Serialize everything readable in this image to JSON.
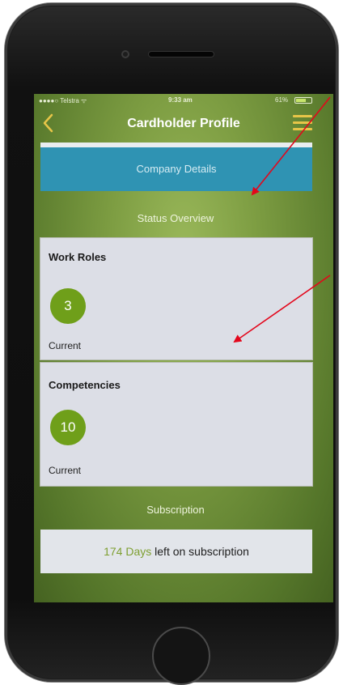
{
  "status_bar": {
    "carrier": "●●●●○ Telstra ᯤ",
    "time": "9:33 am",
    "battery": "61%"
  },
  "nav": {
    "title": "Cardholder Profile",
    "back_icon": "chevron-left-icon",
    "menu_icon": "hamburger-menu-icon",
    "menu_color": "#e7c548"
  },
  "company_details": {
    "label": "Company Details"
  },
  "status_overview": {
    "heading": "Status Overview",
    "work_roles": {
      "title": "Work Roles",
      "count": "3",
      "label": "Current"
    },
    "competencies": {
      "title": "Competencies",
      "count": "10",
      "label": "Current"
    }
  },
  "subscription": {
    "heading": "Subscription",
    "days": "174 Days",
    "suffix": " left on subscription"
  },
  "colors": {
    "accent": "#6f9f1a",
    "company_bar": "#2f93b3",
    "annotation_arrow": "#e3061b"
  }
}
